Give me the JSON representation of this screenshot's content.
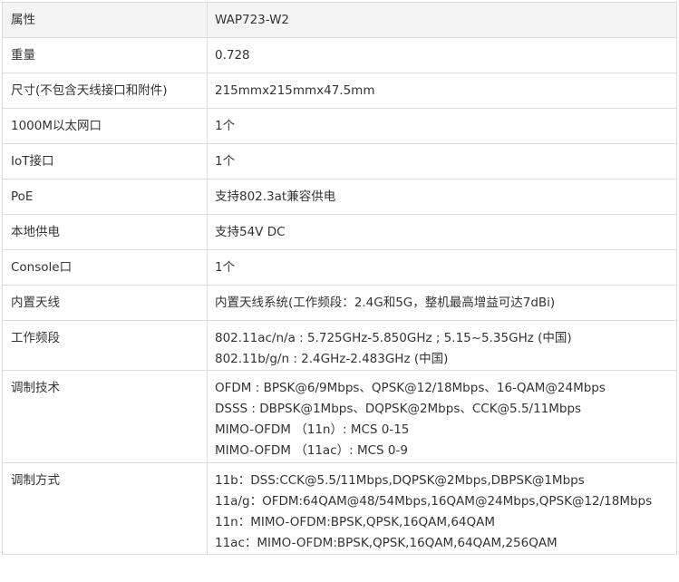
{
  "table": {
    "header": {
      "label": "属性",
      "value": "WAP723-W2"
    },
    "rows": [
      {
        "label": "重量",
        "lines": [
          "0.728"
        ]
      },
      {
        "label": "尺寸(不包含天线接口和附件)",
        "lines": [
          "215mmx215mmx47.5mm"
        ]
      },
      {
        "label": "1000M以太网口",
        "lines": [
          "1个"
        ]
      },
      {
        "label": "IoT接口",
        "lines": [
          "1个"
        ]
      },
      {
        "label": "PoE",
        "lines": [
          "支持802.3at兼容供电"
        ]
      },
      {
        "label": "本地供电",
        "lines": [
          "支持54V DC"
        ]
      },
      {
        "label": "Console口",
        "lines": [
          "1个"
        ]
      },
      {
        "label": "内置天线",
        "lines": [
          "内置天线系统(工作频段：2.4G和5G，整机最高增益可达7dBi)"
        ]
      },
      {
        "label": "工作频段",
        "lines": [
          "802.11ac/n/a : 5.725GHz-5.850GHz ; 5.15~5.35GHz (中国)",
          "802.11b/g/n : 2.4GHz-2.483GHz (中国)"
        ]
      },
      {
        "label": "调制技术",
        "lines": [
          "OFDM : BPSK@6/9Mbps、QPSK@12/18Mbps、16-QAM@24Mbps",
          "DSSS : DBPSK@1Mbps、DQPSK@2Mbps、CCK@5.5/11Mbps",
          "MIMO-OFDM （11n）: MCS 0-15",
          "MIMO-OFDM （11ac）: MCS 0-9"
        ]
      },
      {
        "label": "调制方式",
        "lines": [
          "11b：DSS:CCK@5.5/11Mbps,DQPSK@2Mbps,DBPSK@1Mbps",
          "11a/g：OFDM:64QAM@48/54Mbps,16QAM@24Mbps,QPSK@12/18Mbps",
          "11n：MIMO-OFDM:BPSK,QPSK,16QAM,64QAM",
          "11ac：MIMO-OFDM:BPSK,QPSK,16QAM,64QAM,256QAM"
        ]
      }
    ]
  }
}
